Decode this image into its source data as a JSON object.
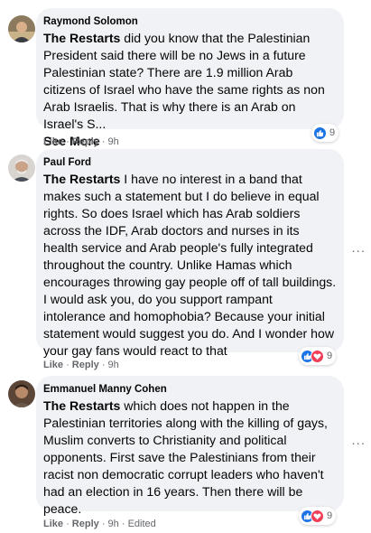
{
  "colors": {
    "bubble": "#f0f2f5",
    "like_blue": "#1b74e4",
    "love_red": "#f33e58",
    "meta_gray": "#65676b",
    "text": "#050505"
  },
  "comments": [
    {
      "author": "Raymond Solomon",
      "mention": "The Restarts",
      "body": " did you know that the Palestinian President said there will be no Jews in a future Palestinian state? There are 1.9 million Arab citizens of Israel who have the same rights as non Arab Israelis. That is why there is an Arab on Israel's S...",
      "see_more": "See More",
      "like_label": "Like",
      "separator": " · ",
      "reply_label": "Reply",
      "time": "9h",
      "edited": "",
      "reactions": [
        "like-icon"
      ],
      "reaction_count": "9"
    },
    {
      "author": "Paul Ford",
      "mention": "The Restarts",
      "body": " I have no interest in a band that makes such a statement but I do believe in equal rights. So does Israel which has Arab soldiers across the IDF, Arab doctors and nurses in its health service and Arab people's fully integrated throughout the country. Unlike Hamas which encourages throwing gay people off of tall buildings. I would ask you, do you support rampant intolerance and homophobia? Because your initial statement would suggest you do. And I wonder how your gay fans would react to that",
      "see_more": "",
      "like_label": "Like",
      "separator": " · ",
      "reply_label": "Reply",
      "time": "9h",
      "edited": "",
      "reactions": [
        "like-icon",
        "love-icon"
      ],
      "reaction_count": "9"
    },
    {
      "author": "Emmanuel Manny Cohen",
      "mention": "The Restarts",
      "body": " which does not happen in the Palestinian territories along with the killing of gays, Muslim converts to Christianity and political opponents. First save the Palestinians from their racist non democratic corrupt leaders who haven't had an election in 16 years. Then there will be peace.",
      "see_more": "",
      "like_label": "Like",
      "separator": " · ",
      "reply_label": "Reply",
      "time": "9h",
      "edited": "Edited",
      "reactions": [
        "like-icon",
        "love-icon"
      ],
      "reaction_count": "9"
    }
  ]
}
